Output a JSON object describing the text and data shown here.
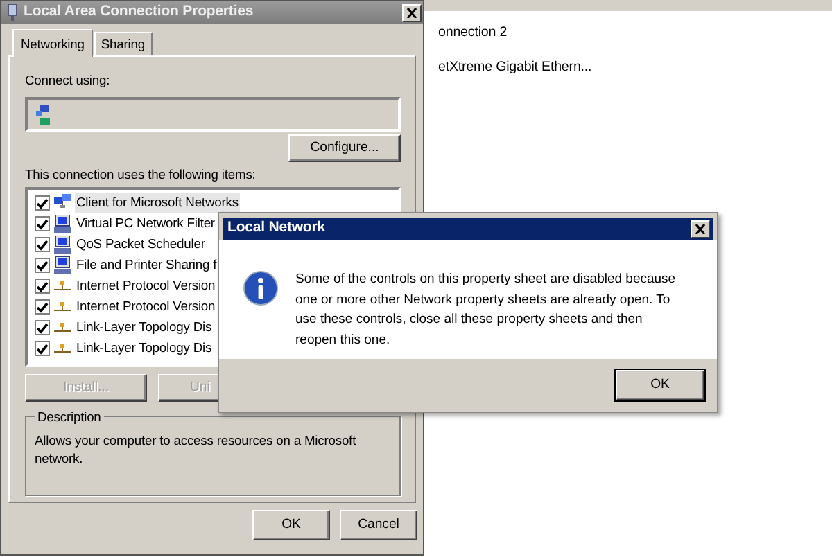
{
  "background_list": {
    "items": [
      "onnection 2",
      "etXtreme Gigabit Ethern..."
    ]
  },
  "properties_window": {
    "title": "Local Area Connection Properties",
    "tabs": [
      {
        "label": "Networking",
        "selected": true
      },
      {
        "label": "Sharing",
        "selected": false
      }
    ],
    "connect_using_label": "Connect using:",
    "configure_button": {
      "label": "Configure..."
    },
    "items_label": "This connection uses the following items:",
    "items": [
      {
        "label": "Client for Microsoft Networks",
        "checked": true,
        "selected": true,
        "kind": "client"
      },
      {
        "label": "Virtual PC Network Filter",
        "checked": true,
        "selected": false,
        "kind": "service"
      },
      {
        "label": "QoS Packet Scheduler",
        "checked": true,
        "selected": false,
        "kind": "service"
      },
      {
        "label": "File and Printer Sharing f",
        "checked": true,
        "selected": false,
        "kind": "service"
      },
      {
        "label": "Internet Protocol Version",
        "checked": true,
        "selected": false,
        "kind": "protocol"
      },
      {
        "label": "Internet Protocol Version",
        "checked": true,
        "selected": false,
        "kind": "protocol"
      },
      {
        "label": "Link-Layer Topology Dis",
        "checked": true,
        "selected": false,
        "kind": "protocol"
      },
      {
        "label": "Link-Layer Topology Dis",
        "checked": true,
        "selected": false,
        "kind": "protocol"
      }
    ],
    "install_button": {
      "label": "Install...",
      "disabled": true
    },
    "uninstall_button": {
      "label": "Uni",
      "disabled": true
    },
    "description": {
      "title": "Description",
      "text": "Allows your computer to access resources on a Microsoft network."
    },
    "buttons": [
      "OK",
      "Cancel"
    ]
  },
  "dialog": {
    "title": "Local Network",
    "message": "Some of the controls on this property sheet are disabled because one or more other Network property sheets are already open.  To use these controls, close all these property sheets and then reopen this one.",
    "buttons": [
      "OK"
    ]
  }
}
